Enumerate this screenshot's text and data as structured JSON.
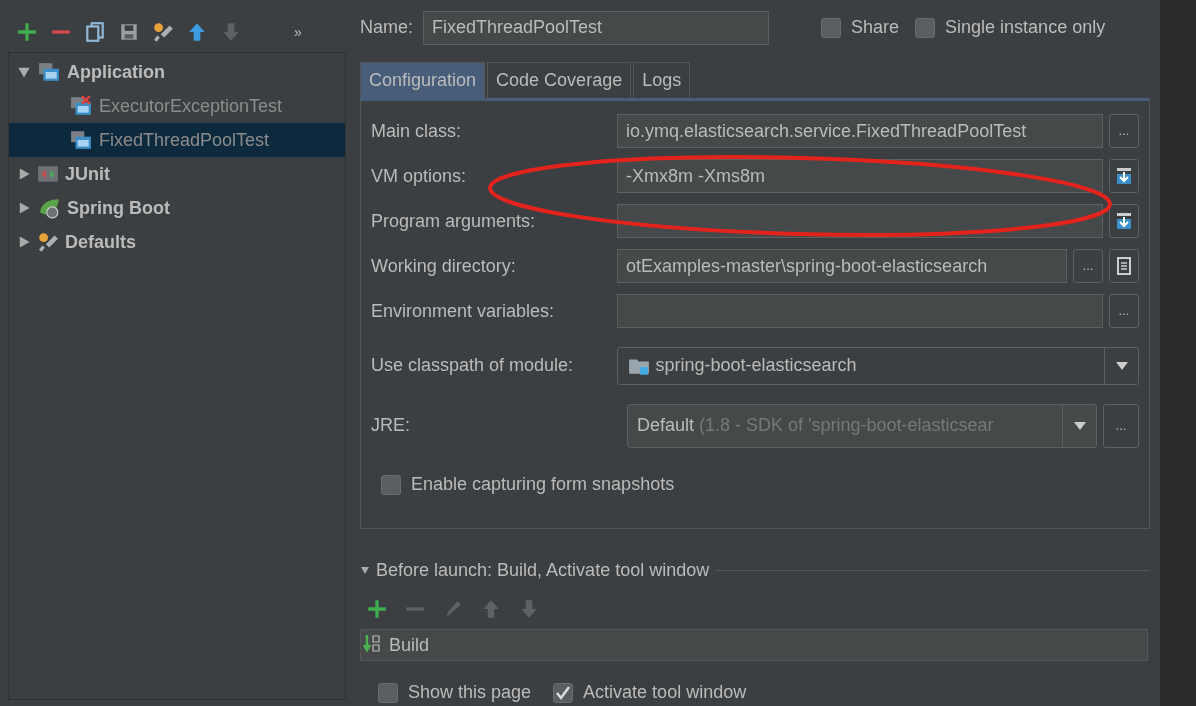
{
  "toolbar": [
    {
      "kind": "add",
      "disabled": false
    },
    {
      "kind": "remove",
      "disabled": false
    },
    {
      "kind": "copy",
      "disabled": false
    },
    {
      "kind": "save",
      "disabled": false
    },
    {
      "kind": "wrench",
      "disabled": false
    },
    {
      "kind": "up",
      "disabled": false
    },
    {
      "kind": "down",
      "disabled": true
    }
  ],
  "toolbar_overflow": "»",
  "tree": [
    {
      "label": "Application",
      "kind": "application",
      "expanded": true,
      "selected": false,
      "children": [
        {
          "label": "ExecutorExceptionTest",
          "kind": "application",
          "error": true,
          "selected": false
        },
        {
          "label": "FixedThreadPoolTest",
          "kind": "application",
          "error": false,
          "selected": true
        }
      ]
    },
    {
      "label": "JUnit",
      "kind": "junit",
      "expanded": false,
      "selected": false
    },
    {
      "label": "Spring Boot",
      "kind": "spring",
      "expanded": false,
      "selected": false
    },
    {
      "label": "Defaults",
      "kind": "wrench",
      "expanded": false,
      "selected": false
    }
  ],
  "name": {
    "label": "Name:",
    "value": "FixedThreadPoolTest"
  },
  "options": [
    {
      "label": "Share",
      "checked": false
    },
    {
      "label": "Single instance only",
      "checked": false
    }
  ],
  "tabs": [
    {
      "label": "Configuration",
      "selected": true
    },
    {
      "label": "Code Coverage",
      "selected": false
    },
    {
      "label": "Logs",
      "selected": false
    }
  ],
  "rows": [
    {
      "kind": "text",
      "label": "Main class:",
      "value": "io.ymq.elasticsearch.service.FixedThreadPoolTest",
      "buttons": [
        {
          "kind": "text",
          "text": "..."
        }
      ]
    },
    {
      "kind": "text",
      "label": "VM options:",
      "value": "-Xmx8m -Xms8m",
      "buttons": [
        {
          "kind": "expand"
        }
      ]
    },
    {
      "kind": "text",
      "label": "Program arguments:",
      "buttons": [
        {
          "kind": "expand"
        }
      ]
    },
    {
      "kind": "text",
      "label": "Working directory:",
      "value": "otExamples-master\\spring-boot-elasticsearch",
      "buttons": [
        {
          "kind": "text",
          "text": "..."
        },
        {
          "kind": "macro"
        }
      ]
    },
    {
      "kind": "text",
      "label": "Environment variables:",
      "buttons": [
        {
          "kind": "text",
          "text": "..."
        }
      ]
    },
    {
      "kind": "module",
      "label": "Use classpath of module:",
      "value": "spring-boot-elasticsearch"
    },
    {
      "kind": "jre",
      "label": "JRE:",
      "value": "Default",
      "detail": "(1.8 - SDK of 'spring-boot-elasticsear",
      "buttons": [
        {
          "kind": "text",
          "text": "..."
        }
      ]
    },
    {
      "kind": "checkbox",
      "label": "Enable capturing form snapshots",
      "checked": false
    }
  ],
  "annotation": {
    "kind": "ellipse",
    "color": "#e5231d"
  },
  "before_launch": {
    "title": "Before launch: Build, Activate tool window",
    "expanded": true,
    "toolbar": [
      {
        "kind": "add",
        "disabled": false
      },
      {
        "kind": "remove",
        "disabled": true
      },
      {
        "kind": "edit",
        "disabled": true
      },
      {
        "kind": "up",
        "disabled": true
      },
      {
        "kind": "down",
        "disabled": true
      }
    ],
    "tasks": [
      {
        "label": "Build",
        "kind": "build"
      }
    ]
  },
  "bottom_options": [
    {
      "label": "Show this page",
      "checked": false
    },
    {
      "label": "Activate tool window",
      "checked": true
    }
  ]
}
